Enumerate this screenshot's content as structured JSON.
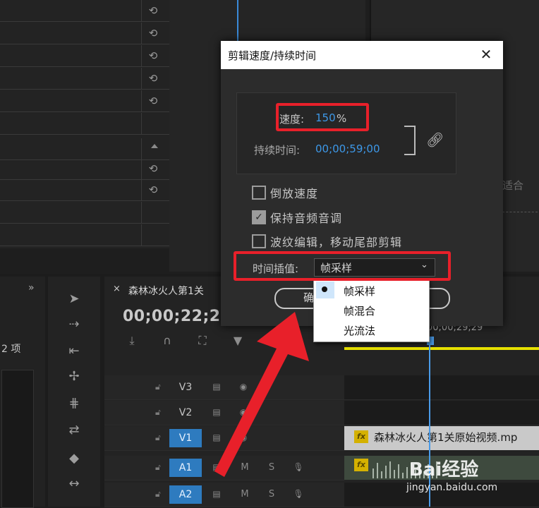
{
  "dialog": {
    "title": "剪辑速度/持续时间",
    "close_glyph": "✕",
    "speed_label": "速度:",
    "speed_value": "150",
    "speed_unit": "%",
    "duration_label": "持续时间:",
    "duration_value": "00;00;59;00",
    "reverse_label": "倒放速度",
    "reverse_checked": false,
    "maintain_pitch_label": "保持音频音调",
    "maintain_pitch_checked": true,
    "ripple_label": "波纹编辑，移动尾部剪辑",
    "ripple_checked": false,
    "interp_label": "时间插值:",
    "interp_value": "帧采样",
    "ok_label": "确",
    "interp_options": [
      "帧采样",
      "帧混合",
      "光流法"
    ]
  },
  "sequence": {
    "tab_title": "森林冰火人第1关",
    "close_glyph": "×",
    "timecode": "00;00;22;23",
    "ruler_time": "00;00;29;29",
    "tracks": [
      "V3",
      "V2",
      "V1",
      "A1",
      "A2"
    ],
    "audio_m": "M",
    "audio_s": "S",
    "clip_name": "森林冰火人第1关原始视频.mp",
    "fx_badge": "fx"
  },
  "project": {
    "count": "2 项",
    "chevron": "»"
  },
  "right_panel": {
    "partial_text": "适合"
  },
  "watermark": {
    "logo": "Bai经验",
    "url": "jingyan.baidu.com"
  },
  "colors": {
    "accent_blue": "#3d98e8",
    "highlight_red": "#e8202a",
    "track_active": "#2e7bbf",
    "work_area_yellow": "#e6e000"
  }
}
